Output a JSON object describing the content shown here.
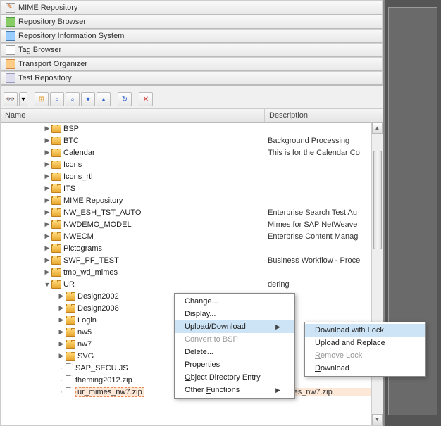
{
  "nav": [
    {
      "label": "MIME Repository",
      "iconClass": "i-mime"
    },
    {
      "label": "Repository Browser",
      "iconClass": "i-repo"
    },
    {
      "label": "Repository Information System",
      "iconClass": "i-info"
    },
    {
      "label": "Tag Browser",
      "iconClass": "i-tag"
    },
    {
      "label": "Transport Organizer",
      "iconClass": "i-transport"
    },
    {
      "label": "Test Repository",
      "iconClass": "i-test"
    }
  ],
  "columns": {
    "name": "Name",
    "desc": "Description"
  },
  "tree": [
    {
      "indent": 60,
      "exp": "▶",
      "type": "folder",
      "label": "BSP",
      "desc": ""
    },
    {
      "indent": 60,
      "exp": "▶",
      "type": "folder",
      "label": "BTC",
      "desc": "Background Processing"
    },
    {
      "indent": 60,
      "exp": "▶",
      "type": "folder",
      "label": "Calendar",
      "desc": "This is for the Calendar Co"
    },
    {
      "indent": 60,
      "exp": "▶",
      "type": "folder",
      "label": "Icons",
      "desc": ""
    },
    {
      "indent": 60,
      "exp": "▶",
      "type": "folder",
      "label": "Icons_rtl",
      "desc": ""
    },
    {
      "indent": 60,
      "exp": "▶",
      "type": "folder",
      "label": "ITS",
      "desc": ""
    },
    {
      "indent": 60,
      "exp": "▶",
      "type": "folder",
      "label": "MIME Repository",
      "desc": ""
    },
    {
      "indent": 60,
      "exp": "▶",
      "type": "folder",
      "label": "NW_ESH_TST_AUTO",
      "desc": "Enterprise Search Test Au"
    },
    {
      "indent": 60,
      "exp": "▶",
      "type": "folder",
      "label": "NWDEMO_MODEL",
      "desc": "Mimes for SAP NetWeave"
    },
    {
      "indent": 60,
      "exp": "▶",
      "type": "folder",
      "label": "NWECM",
      "desc": "Enterprise Content Manag"
    },
    {
      "indent": 60,
      "exp": "▶",
      "type": "folder",
      "label": "Pictograms",
      "desc": ""
    },
    {
      "indent": 60,
      "exp": "▶",
      "type": "folder",
      "label": "SWF_PF_TEST",
      "desc": "Business Workflow - Proce"
    },
    {
      "indent": 60,
      "exp": "▶",
      "type": "folder",
      "label": "tmp_wd_mimes",
      "desc": ""
    },
    {
      "indent": 60,
      "exp": "▼",
      "type": "folder",
      "label": "UR",
      "desc": "dering"
    },
    {
      "indent": 80,
      "exp": "▶",
      "type": "folder",
      "label": "Design2002",
      "desc": ""
    },
    {
      "indent": 80,
      "exp": "▶",
      "type": "folder",
      "label": "Design2008",
      "desc": ""
    },
    {
      "indent": 80,
      "exp": "▶",
      "type": "folder",
      "label": "Login",
      "desc": ""
    },
    {
      "indent": 80,
      "exp": "▶",
      "type": "folder",
      "label": "nw5",
      "desc": ""
    },
    {
      "indent": 80,
      "exp": "▶",
      "type": "folder",
      "label": "nw7",
      "desc": ""
    },
    {
      "indent": 80,
      "exp": "▶",
      "type": "folder",
      "label": "SVG",
      "desc": ""
    },
    {
      "indent": 80,
      "exp": "·",
      "type": "file",
      "label": "SAP_SECU.JS",
      "desc": ""
    },
    {
      "indent": 80,
      "exp": "·",
      "type": "file",
      "label": "theming2012.zip",
      "desc": ""
    },
    {
      "indent": 80,
      "exp": "·",
      "type": "file",
      "label": "ur_mimes_nw7.zip",
      "desc": "ur_mimes_nw7.zip",
      "selected": true
    }
  ],
  "contextMenu": {
    "items": [
      {
        "label": "Change...",
        "u": "",
        "enabled": true
      },
      {
        "label": "Display...",
        "u": "",
        "enabled": true
      },
      {
        "label": "Upload/Download",
        "u": "U",
        "enabled": true,
        "arrow": true,
        "active": true
      },
      {
        "label": "Convert to BSP",
        "u": "",
        "enabled": false
      },
      {
        "label": "Delete...",
        "u": "",
        "enabled": true
      },
      {
        "label": "Properties",
        "u": "P",
        "enabled": true
      },
      {
        "label": "Object Directory Entry",
        "u": "O",
        "enabled": true
      },
      {
        "label": "Other Functions",
        "u": "F",
        "enabled": true,
        "arrow": true
      }
    ]
  },
  "submenu": {
    "items": [
      {
        "label": "Download with Lock",
        "u": "",
        "enabled": true,
        "active": true
      },
      {
        "label": "Upload and Replace",
        "u": "",
        "enabled": true
      },
      {
        "label": "Remove Lock",
        "u": "R",
        "enabled": false
      },
      {
        "label": "Download",
        "u": "D",
        "enabled": true
      }
    ]
  }
}
